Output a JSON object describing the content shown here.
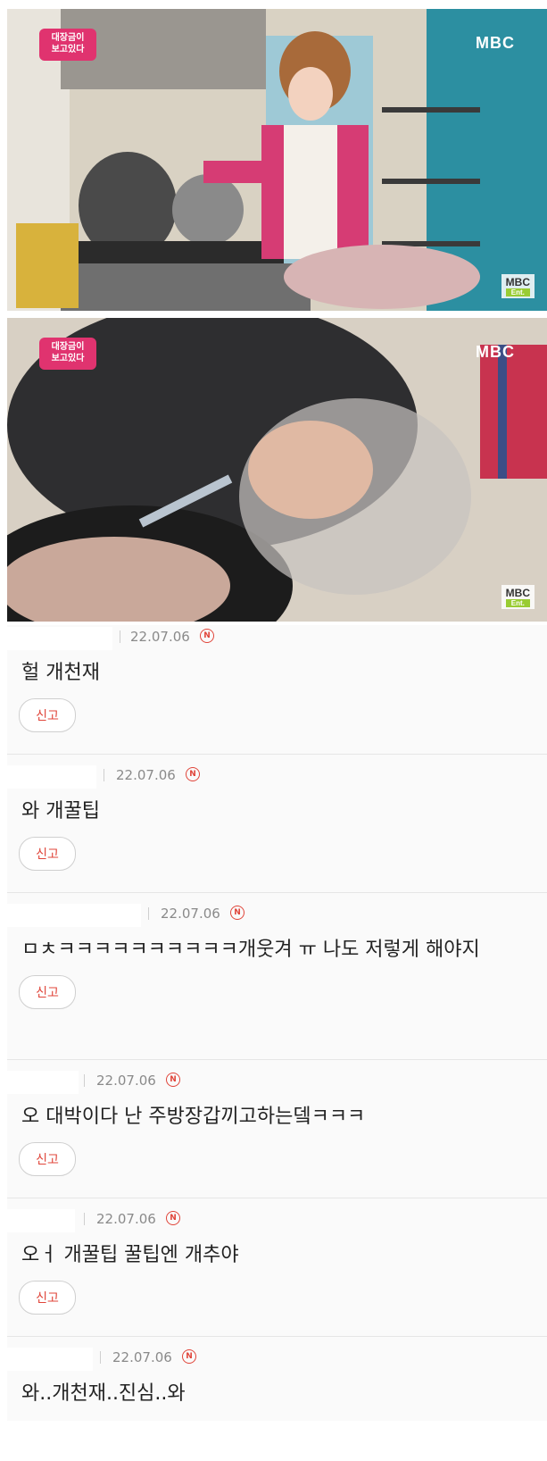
{
  "video_frames": [
    {
      "show_logo": "대장금이\n보고있다",
      "broadcaster_logo": "MBC",
      "corner_logo": "MBC",
      "corner_sub": "Ent."
    },
    {
      "show_logo": "대장금이\n보고있다",
      "broadcaster_logo": "MBC",
      "corner_logo": "MBC",
      "corner_sub": "Ent."
    }
  ],
  "comments": [
    {
      "date": "22.07.06",
      "badge": "N",
      "text": "헐 개천재",
      "report_label": "신고"
    },
    {
      "date": "22.07.06",
      "badge": "N",
      "text": "와 개꿀팁",
      "report_label": "신고"
    },
    {
      "date": "22.07.06",
      "badge": "N",
      "text": "ㅁㅊㅋㅋㅋㅋㅋㅋㅋㅋㅋㅋ개웃겨 ㅠ 나도 저렇게 해야지",
      "report_label": "신고"
    },
    {
      "date": "22.07.06",
      "badge": "N",
      "text": "오 대박이다 난 주방장갑끼고하는뎈ㅋㅋㅋ",
      "report_label": "신고"
    },
    {
      "date": "22.07.06",
      "badge": "N",
      "text": "오ㅓ 개꿀팁 꿀팁엔 개추야",
      "report_label": "신고"
    },
    {
      "date": "22.07.06",
      "badge": "N",
      "text": "와..개천재..진심..와"
    }
  ]
}
